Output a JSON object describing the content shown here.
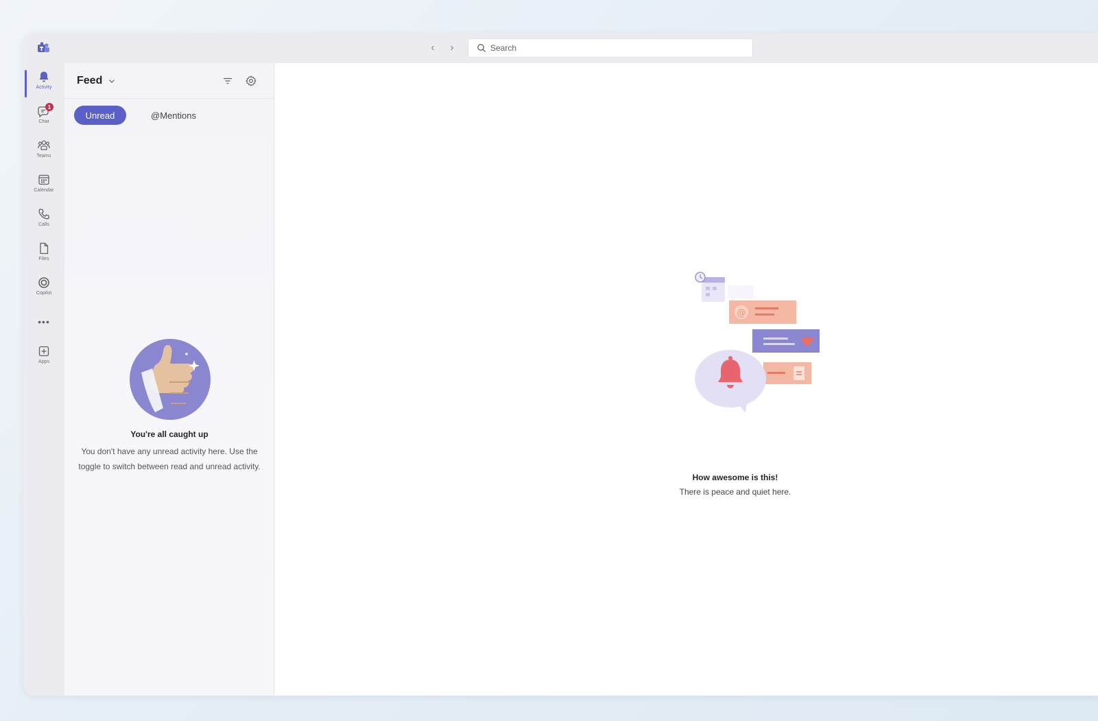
{
  "titlebar": {
    "search_placeholder": "Search"
  },
  "rail": {
    "items": [
      {
        "label": "Activity",
        "icon": "bell-icon",
        "active": true
      },
      {
        "label": "Chat",
        "icon": "chat-icon",
        "badge": "1"
      },
      {
        "label": "Teams",
        "icon": "teams-icon"
      },
      {
        "label": "Calendar",
        "icon": "calendar-icon"
      },
      {
        "label": "Calls",
        "icon": "phone-icon"
      },
      {
        "label": "Files",
        "icon": "file-icon"
      },
      {
        "label": "Copilot",
        "icon": "copilot-icon"
      },
      {
        "label": "•••",
        "icon": "more-icon"
      },
      {
        "label": "Apps",
        "icon": "add-app-icon"
      }
    ]
  },
  "feed": {
    "title": "Feed",
    "filters": {
      "unread": "Unread",
      "mentions": "@Mentions"
    },
    "empty_title": "You're all caught up",
    "empty_body": "You don't have any unread activity here. Use the toggle to switch between read and unread activity."
  },
  "main": {
    "empty_title": "How awesome is this!",
    "empty_body": "There is peace and quiet here."
  },
  "colors": {
    "accent": "#5b5fc7",
    "badge": "#c4314b",
    "illustration_purple": "#8b86d0",
    "illustration_salmon": "#f4b7a3"
  }
}
